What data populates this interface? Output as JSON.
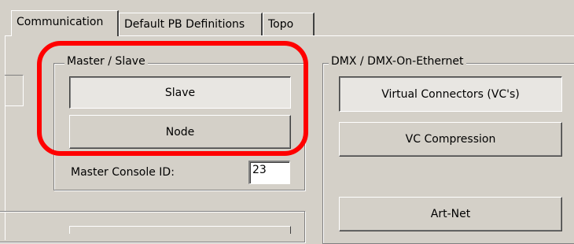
{
  "tabs": [
    {
      "label": "Communication"
    },
    {
      "label": "Default PB Definitions"
    },
    {
      "label": "Topo"
    }
  ],
  "master_slave": {
    "legend": "Master / Slave",
    "slave_label": "Slave",
    "node_label": "Node",
    "console_id_label": "Master Console ID:",
    "console_id_value": "23"
  },
  "dmx": {
    "legend": "DMX / DMX-On-Ethernet",
    "virtual_connectors_label": "Virtual Connectors (VC's)",
    "vc_compression_label": "VC Compression",
    "art_net_label": "Art-Net"
  },
  "colors": {
    "background": "#d4d0c8",
    "highlight": "#ff0000"
  }
}
